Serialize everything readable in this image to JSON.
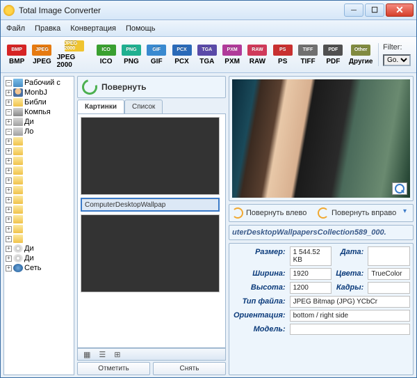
{
  "window": {
    "title": "Total Image Converter"
  },
  "menu": {
    "file": "Файл",
    "edit": "Правка",
    "convert": "Конвертация",
    "help": "Помощь"
  },
  "formats": [
    {
      "badge": "BMP",
      "color": "#d62424",
      "label": "BMP"
    },
    {
      "badge": "JPEG",
      "color": "#e67a10",
      "label": "JPEG"
    },
    {
      "badge": "JPEG 2000",
      "color": "#f0c430",
      "label": "JPEG 2000"
    },
    {
      "badge": "ICO",
      "color": "#3aa030",
      "label": "ICO"
    },
    {
      "badge": "PNG",
      "color": "#20b090",
      "label": "PNG"
    },
    {
      "badge": "GIF",
      "color": "#3a8ad0",
      "label": "GIF"
    },
    {
      "badge": "PCX",
      "color": "#2a6ab8",
      "label": "PCX"
    },
    {
      "badge": "TGA",
      "color": "#5a4aa8",
      "label": "TGA"
    },
    {
      "badge": "PXM",
      "color": "#b03a9a",
      "label": "PXM"
    },
    {
      "badge": "RAW",
      "color": "#d03a5a",
      "label": "RAW"
    },
    {
      "badge": "PS",
      "color": "#c83030",
      "label": "PS"
    },
    {
      "badge": "TIFF",
      "color": "#707070",
      "label": "TIFF"
    },
    {
      "badge": "PDF",
      "color": "#505050",
      "label": "PDF"
    },
    {
      "badge": "Other",
      "color": "#808a40",
      "label": "Другие"
    }
  ],
  "filter": {
    "label": "Filter:",
    "value": "Go.."
  },
  "tree": {
    "root": "Рабочий с",
    "user": "MonbJ",
    "lib": "Библи",
    "comp": "Компья",
    "disk": "Ди",
    "local": "Ло",
    "d2": "Ди",
    "d3": "Ди",
    "net": "Сеть"
  },
  "rotate": {
    "title": "Повернуть",
    "left": "Повернуть влево",
    "right": "Повернуть вправо"
  },
  "tabs": {
    "pics": "Картинки",
    "list": "Список"
  },
  "thumbs": {
    "caption2": "ComputerDesktopWallpap"
  },
  "actions": {
    "unmark": "Отметить",
    "clear": "Снять"
  },
  "filename": "uterDesktopWallpapersCollection589_000.",
  "info": {
    "size_k": "Размер:",
    "size_v": "1 544.52 KB",
    "date_k": "Дата:",
    "date_v": "",
    "width_k": "Ширина:",
    "width_v": "1920",
    "color_k": "Цвета:",
    "color_v": "TrueColor",
    "height_k": "Высота:",
    "height_v": "1200",
    "frames_k": "Кадры:",
    "frames_v": "",
    "type_k": "Тип файла:",
    "type_v": "JPEG Bitmap (JPG) YCbCr",
    "orient_k": "Ориентация:",
    "orient_v": "bottom / right side",
    "model_k": "Модель:",
    "model_v": ""
  }
}
